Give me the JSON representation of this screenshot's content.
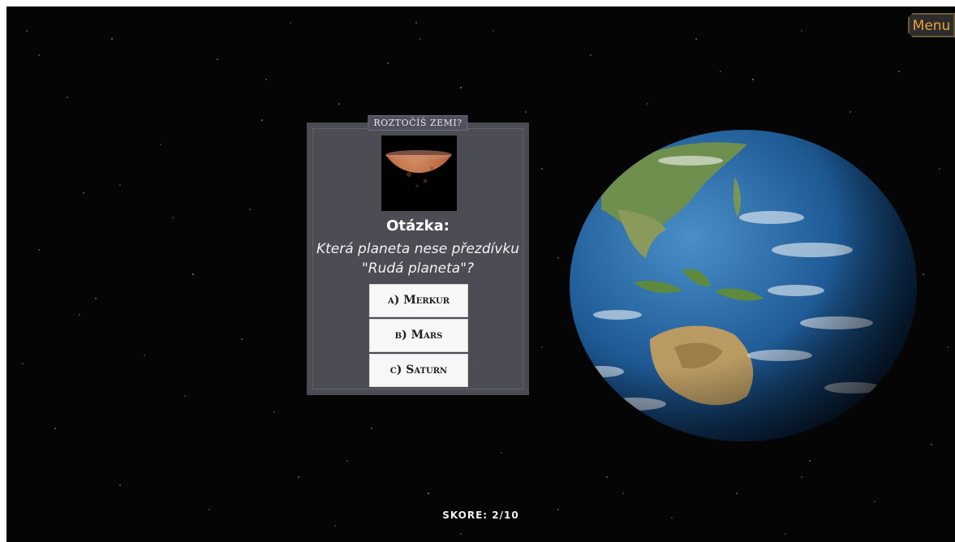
{
  "menu": {
    "label": "Menu"
  },
  "quiz": {
    "title": "Roztočíš Zemi?",
    "question_label": "Otázka:",
    "question_text": "Která planeta nese přezdívku \"Rudá planeta\"?",
    "answers": [
      {
        "label": "a) Merkur"
      },
      {
        "label": "b) Mars"
      },
      {
        "label": "c) Saturn"
      }
    ],
    "image_icon": "mars-planet-icon"
  },
  "score": {
    "text": "SKORE: 2/10"
  },
  "colors": {
    "menu_text": "#e6a23c",
    "panel_bg": "#565860",
    "space_bg": "#050505"
  }
}
